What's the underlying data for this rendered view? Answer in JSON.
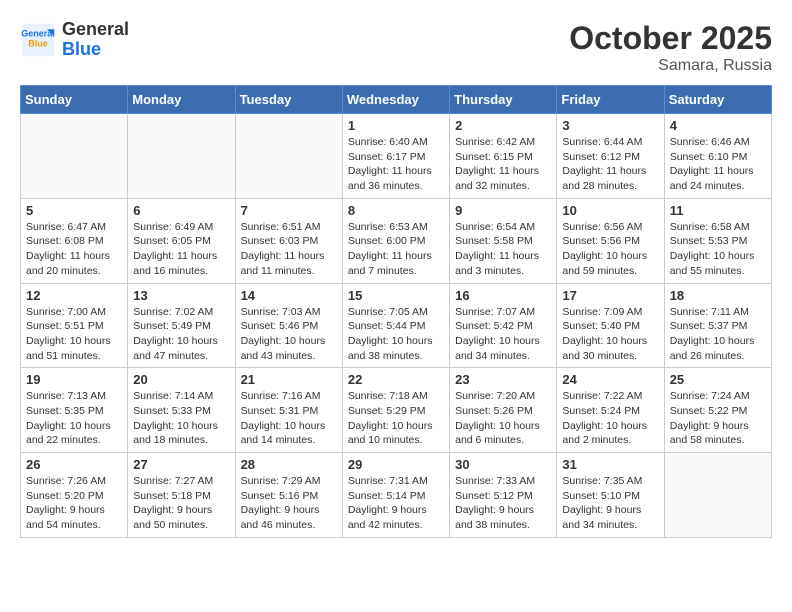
{
  "header": {
    "logo_line1": "General",
    "logo_line2": "Blue",
    "month": "October 2025",
    "location": "Samara, Russia"
  },
  "weekdays": [
    "Sunday",
    "Monday",
    "Tuesday",
    "Wednesday",
    "Thursday",
    "Friday",
    "Saturday"
  ],
  "weeks": [
    [
      {
        "day": "",
        "info": ""
      },
      {
        "day": "",
        "info": ""
      },
      {
        "day": "",
        "info": ""
      },
      {
        "day": "1",
        "info": "Sunrise: 6:40 AM\nSunset: 6:17 PM\nDaylight: 11 hours\nand 36 minutes."
      },
      {
        "day": "2",
        "info": "Sunrise: 6:42 AM\nSunset: 6:15 PM\nDaylight: 11 hours\nand 32 minutes."
      },
      {
        "day": "3",
        "info": "Sunrise: 6:44 AM\nSunset: 6:12 PM\nDaylight: 11 hours\nand 28 minutes."
      },
      {
        "day": "4",
        "info": "Sunrise: 6:46 AM\nSunset: 6:10 PM\nDaylight: 11 hours\nand 24 minutes."
      }
    ],
    [
      {
        "day": "5",
        "info": "Sunrise: 6:47 AM\nSunset: 6:08 PM\nDaylight: 11 hours\nand 20 minutes."
      },
      {
        "day": "6",
        "info": "Sunrise: 6:49 AM\nSunset: 6:05 PM\nDaylight: 11 hours\nand 16 minutes."
      },
      {
        "day": "7",
        "info": "Sunrise: 6:51 AM\nSunset: 6:03 PM\nDaylight: 11 hours\nand 11 minutes."
      },
      {
        "day": "8",
        "info": "Sunrise: 6:53 AM\nSunset: 6:00 PM\nDaylight: 11 hours\nand 7 minutes."
      },
      {
        "day": "9",
        "info": "Sunrise: 6:54 AM\nSunset: 5:58 PM\nDaylight: 11 hours\nand 3 minutes."
      },
      {
        "day": "10",
        "info": "Sunrise: 6:56 AM\nSunset: 5:56 PM\nDaylight: 10 hours\nand 59 minutes."
      },
      {
        "day": "11",
        "info": "Sunrise: 6:58 AM\nSunset: 5:53 PM\nDaylight: 10 hours\nand 55 minutes."
      }
    ],
    [
      {
        "day": "12",
        "info": "Sunrise: 7:00 AM\nSunset: 5:51 PM\nDaylight: 10 hours\nand 51 minutes."
      },
      {
        "day": "13",
        "info": "Sunrise: 7:02 AM\nSunset: 5:49 PM\nDaylight: 10 hours\nand 47 minutes."
      },
      {
        "day": "14",
        "info": "Sunrise: 7:03 AM\nSunset: 5:46 PM\nDaylight: 10 hours\nand 43 minutes."
      },
      {
        "day": "15",
        "info": "Sunrise: 7:05 AM\nSunset: 5:44 PM\nDaylight: 10 hours\nand 38 minutes."
      },
      {
        "day": "16",
        "info": "Sunrise: 7:07 AM\nSunset: 5:42 PM\nDaylight: 10 hours\nand 34 minutes."
      },
      {
        "day": "17",
        "info": "Sunrise: 7:09 AM\nSunset: 5:40 PM\nDaylight: 10 hours\nand 30 minutes."
      },
      {
        "day": "18",
        "info": "Sunrise: 7:11 AM\nSunset: 5:37 PM\nDaylight: 10 hours\nand 26 minutes."
      }
    ],
    [
      {
        "day": "19",
        "info": "Sunrise: 7:13 AM\nSunset: 5:35 PM\nDaylight: 10 hours\nand 22 minutes."
      },
      {
        "day": "20",
        "info": "Sunrise: 7:14 AM\nSunset: 5:33 PM\nDaylight: 10 hours\nand 18 minutes."
      },
      {
        "day": "21",
        "info": "Sunrise: 7:16 AM\nSunset: 5:31 PM\nDaylight: 10 hours\nand 14 minutes."
      },
      {
        "day": "22",
        "info": "Sunrise: 7:18 AM\nSunset: 5:29 PM\nDaylight: 10 hours\nand 10 minutes."
      },
      {
        "day": "23",
        "info": "Sunrise: 7:20 AM\nSunset: 5:26 PM\nDaylight: 10 hours\nand 6 minutes."
      },
      {
        "day": "24",
        "info": "Sunrise: 7:22 AM\nSunset: 5:24 PM\nDaylight: 10 hours\nand 2 minutes."
      },
      {
        "day": "25",
        "info": "Sunrise: 7:24 AM\nSunset: 5:22 PM\nDaylight: 9 hours\nand 58 minutes."
      }
    ],
    [
      {
        "day": "26",
        "info": "Sunrise: 7:26 AM\nSunset: 5:20 PM\nDaylight: 9 hours\nand 54 minutes."
      },
      {
        "day": "27",
        "info": "Sunrise: 7:27 AM\nSunset: 5:18 PM\nDaylight: 9 hours\nand 50 minutes."
      },
      {
        "day": "28",
        "info": "Sunrise: 7:29 AM\nSunset: 5:16 PM\nDaylight: 9 hours\nand 46 minutes."
      },
      {
        "day": "29",
        "info": "Sunrise: 7:31 AM\nSunset: 5:14 PM\nDaylight: 9 hours\nand 42 minutes."
      },
      {
        "day": "30",
        "info": "Sunrise: 7:33 AM\nSunset: 5:12 PM\nDaylight: 9 hours\nand 38 minutes."
      },
      {
        "day": "31",
        "info": "Sunrise: 7:35 AM\nSunset: 5:10 PM\nDaylight: 9 hours\nand 34 minutes."
      },
      {
        "day": "",
        "info": ""
      }
    ]
  ]
}
